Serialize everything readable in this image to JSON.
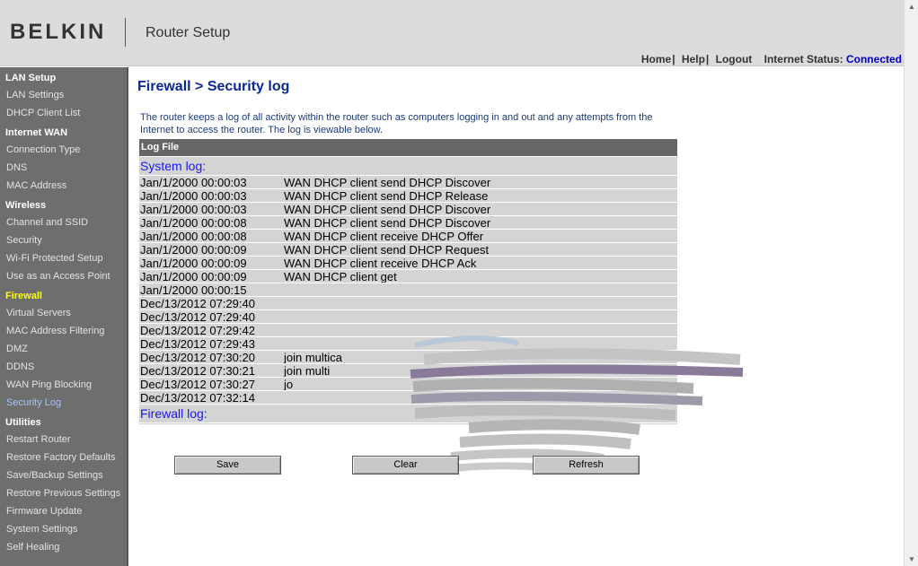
{
  "header": {
    "brand": "BELKIN",
    "title": "Router Setup",
    "links": {
      "home": "Home",
      "help": "Help",
      "logout": "Logout"
    },
    "link_separator": "|",
    "status_label": "Internet Status:",
    "status_value": "Connected"
  },
  "sidebar": {
    "lan_setup": {
      "title": "LAN Setup",
      "items": [
        "LAN Settings",
        "DHCP Client List"
      ]
    },
    "internet_wan": {
      "title": "Internet WAN",
      "items": [
        "Connection Type",
        "DNS",
        "MAC Address"
      ]
    },
    "wireless": {
      "title": "Wireless",
      "items": [
        "Channel and SSID",
        "Security",
        "Wi-Fi Protected Setup",
        "Use as an Access Point"
      ]
    },
    "firewall": {
      "title": "Firewall",
      "items": [
        "Virtual Servers",
        "MAC Address Filtering",
        "DMZ",
        "DDNS",
        "WAN Ping Blocking",
        "Security Log"
      ]
    },
    "utilities": {
      "title": "Utilities",
      "items": [
        "Restart Router",
        "Restore Factory Defaults",
        "Save/Backup Settings",
        "Restore Previous Settings",
        "Firmware Update",
        "System Settings",
        "Self Healing"
      ]
    }
  },
  "main": {
    "title": "Firewall > Security log",
    "intro": "The router keeps a log of all activity within the router such as computers logging in and out and any attempts from the Internet to access the router. The log is viewable below.",
    "log_header": "Log File",
    "system_log_label": "System log:",
    "firewall_log_label": "Firewall log:",
    "system_log": [
      {
        "time": "Jan/1/2000 00:00:03",
        "msg": "WAN DHCP client send DHCP Discover"
      },
      {
        "time": "Jan/1/2000 00:00:03",
        "msg": "WAN DHCP client send DHCP Release"
      },
      {
        "time": "Jan/1/2000 00:00:03",
        "msg": "WAN DHCP client send DHCP Discover"
      },
      {
        "time": "Jan/1/2000 00:00:08",
        "msg": "WAN DHCP client send DHCP Discover"
      },
      {
        "time": "Jan/1/2000 00:00:08",
        "msg": "WAN DHCP client receive DHCP Offer"
      },
      {
        "time": "Jan/1/2000 00:00:09",
        "msg": "WAN DHCP client send DHCP Request"
      },
      {
        "time": "Jan/1/2000 00:00:09",
        "msg": "WAN DHCP client receive DHCP Ack"
      },
      {
        "time": "Jan/1/2000 00:00:09",
        "msg": "WAN DHCP client get"
      },
      {
        "time": "Jan/1/2000 00:00:15",
        "msg": ""
      },
      {
        "time": "Dec/13/2012 07:29:40",
        "msg": ""
      },
      {
        "time": "Dec/13/2012 07:29:40",
        "msg": ""
      },
      {
        "time": "Dec/13/2012 07:29:42",
        "msg": ""
      },
      {
        "time": "Dec/13/2012 07:29:43",
        "msg": ""
      },
      {
        "time": "Dec/13/2012 07:30:20",
        "msg": "join multica"
      },
      {
        "time": "Dec/13/2012 07:30:21",
        "msg": "join multi"
      },
      {
        "time": "Dec/13/2012 07:30:27",
        "msg": "jo"
      },
      {
        "time": "Dec/13/2012 07:32:14",
        "msg": ""
      }
    ],
    "buttons": {
      "save": "Save",
      "clear": "Clear",
      "refresh": "Refresh"
    }
  }
}
